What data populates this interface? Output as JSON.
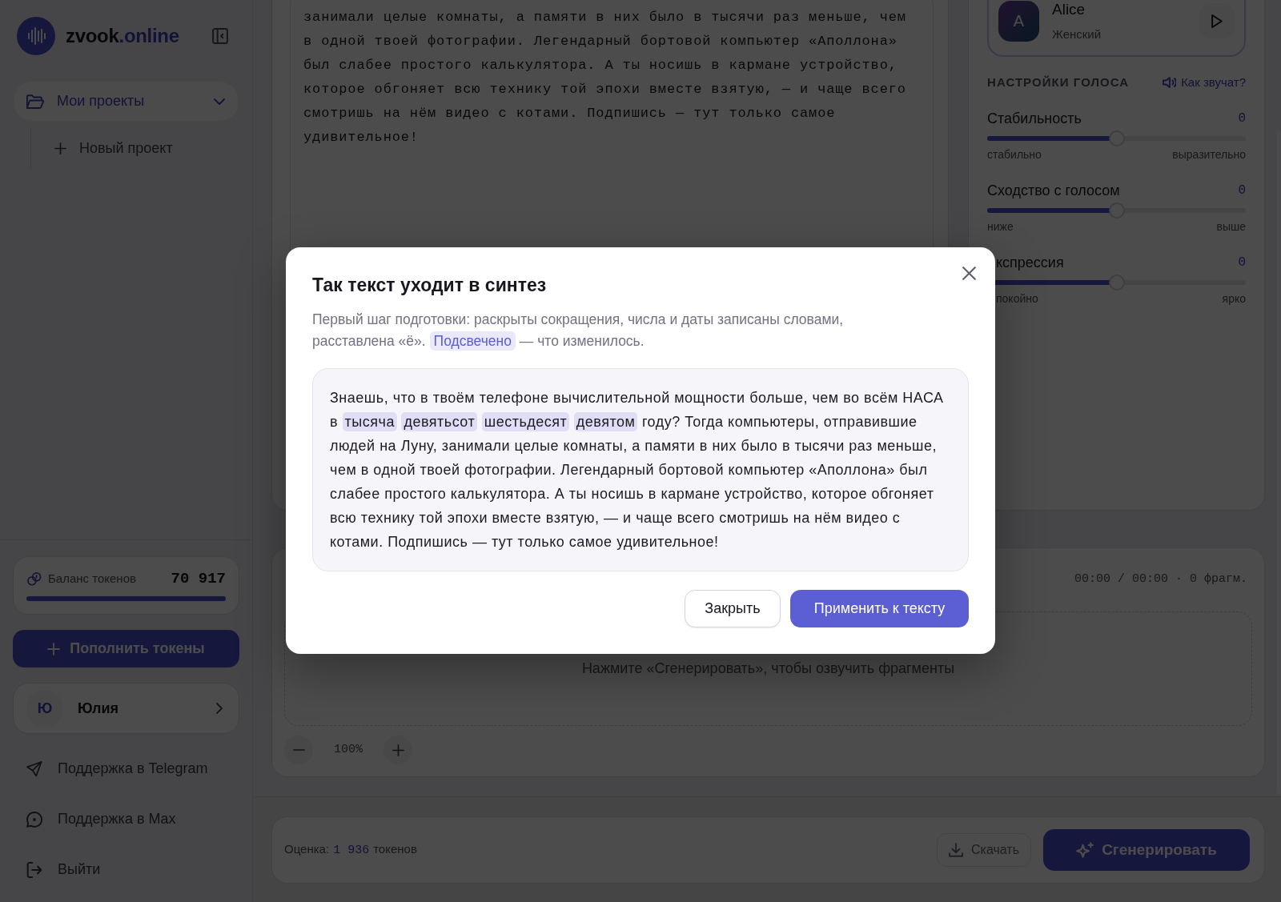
{
  "sidebar": {
    "brand": {
      "name": "zvook",
      "domain": ".online"
    },
    "projects": {
      "label": "Мои проекты",
      "expanded": true,
      "children": [
        {
          "label": "Новый проект"
        }
      ]
    },
    "balance": {
      "label": "Баланс токенов",
      "value": "70 917",
      "level": 1
    },
    "top_up_button": "Пополнить токены",
    "user": {
      "initial": "Ю",
      "name": "Юлия"
    },
    "links": [
      {
        "kind": "send",
        "label": "Поддержка в Telegram"
      },
      {
        "kind": "chat",
        "label": "Поддержка в Max"
      },
      {
        "kind": "logout",
        "label": "Выйти"
      }
    ]
  },
  "editor": {
    "lines": [
      "занимали целые комнаты, а памяти в них было в тысячи раз меньше, чем",
      "в одной твоей фотографии. Легендарный бортовой компьютер «Аполлона»",
      "был слабее простого калькулятора. А ты носишь в кармане устройство,",
      "которое обгоняет всю технику той эпохи вместе взятую, — и чаще всего",
      "смотришь на нём видео с котами. Подпишись — тут только самое",
      "удивительное!"
    ]
  },
  "voice": {
    "avatar_letter": "A",
    "name": "Alice",
    "gender": "Женский"
  },
  "voice_settings": {
    "title": "НАСТРОЙКИ ГОЛОСА",
    "preview_link": "Как звучат?",
    "sliders": [
      {
        "label": "Стабильность",
        "value": "0",
        "level": 0.5,
        "min_label": "стабильно",
        "max_label": "выразительно"
      },
      {
        "label": "Сходство с голосом",
        "value": "0",
        "level": 0.5,
        "min_label": "ниже",
        "max_label": "выше"
      },
      {
        "label": "кспрессия",
        "value": "0",
        "level": 0.5,
        "min_label": "покойно",
        "max_label": "ярко",
        "partly_hidden": true
      }
    ]
  },
  "player": {
    "time": "00:00 / 00:00",
    "separator": "·",
    "fragments": "0 фрагм.",
    "empty_hint": "Нажмите «Сгенерировать», чтобы озвучить фрагменты",
    "zoom": "100%"
  },
  "footer": {
    "estimate_label": "Оценка:",
    "estimate_value": "1 936",
    "estimate_unit": "токенов",
    "download_button": {
      "label": "Скачать",
      "disabled": true
    },
    "generate_button": "Сгенерировать"
  },
  "dialog": {
    "title": "Так текст уходит в синтез",
    "description": [
      {
        "text": "Первый шаг подготовки: раскрыты сокращения, числа и даты записаны словами, расставлена «ё».",
        "highlighted": false
      },
      {
        "text": "Подсвечено",
        "highlighted": true
      },
      {
        "text": "— что изменилось.",
        "highlighted": false
      }
    ],
    "result": [
      {
        "text": "Знаешь, что в твоём телефоне вычислительной мощности больше, чем во всём НАСА в",
        "highlighted": false
      },
      {
        "text": "тысяча",
        "highlighted": true
      },
      {
        "text": "девятьсот",
        "highlighted": true
      },
      {
        "text": "шестьдесят",
        "highlighted": true
      },
      {
        "text": "девятом",
        "highlighted": true
      },
      {
        "text": "году? Тогда компьютеры, отправившие людей на Луну, занимали целые комнаты, а памяти в них было в тысячи раз меньше, чем в одной твоей фотографии. Легендарный бортовой компьютер «Аполлона» был слабее простого калькулятора. А ты носишь в кармане устройство, которое обгоняет всю технику той эпохи вместе взятую, — и чаще всего смотришь на нём видео с котами. Подпишись — тут только самое удивительное!",
        "highlighted": false
      }
    ],
    "buttons": [
      {
        "label": "Закрыть",
        "kind": "secondary"
      },
      {
        "label": "Применить к тексту",
        "kind": "primary"
      }
    ]
  }
}
